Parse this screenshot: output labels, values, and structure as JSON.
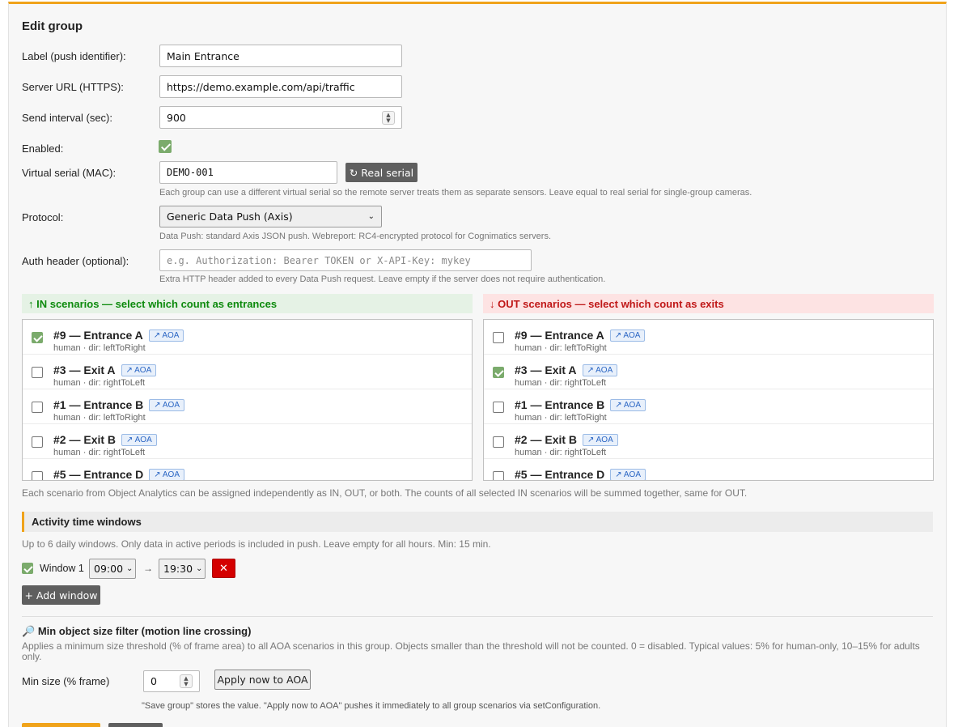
{
  "form": {
    "title": "Edit group",
    "label_field": {
      "label": "Label (push identifier):",
      "value": "Main Entrance"
    },
    "server_url": {
      "label": "Server URL (HTTPS):",
      "value": "https://demo.example.com/api/traffic"
    },
    "send_interval": {
      "label": "Send interval (sec):",
      "value": "900"
    },
    "enabled": {
      "label": "Enabled:",
      "checked": true
    },
    "virtual_serial": {
      "label": "Virtual serial (MAC):",
      "value": "DEMO-001",
      "button": "↻ Real serial",
      "help": "Each group can use a different virtual serial so the remote server treats them as separate sensors. Leave equal to real serial for single-group cameras."
    },
    "protocol": {
      "label": "Protocol:",
      "selected": "Generic Data Push (Axis)",
      "help": "Data Push: standard Axis JSON push. Webreport: RC4-encrypted protocol for Cognimatics servers."
    },
    "auth_header": {
      "label": "Auth header (optional):",
      "placeholder": "e.g. Authorization: Bearer TOKEN  or  X-API-Key: mykey",
      "help": "Extra HTTP header added to every Data Push request. Leave empty if the server does not require authentication."
    }
  },
  "scenarios": {
    "in_header": "↑ IN scenarios — select which count as entrances",
    "out_header": "↓ OUT scenarios — select which count as exits",
    "aoa_badge": "↗ AOA",
    "in": [
      {
        "name": "#9 — Entrance A",
        "meta": "human · dir: leftToRight",
        "checked": true
      },
      {
        "name": "#3 — Exit A",
        "meta": "human · dir: rightToLeft",
        "checked": false
      },
      {
        "name": "#1 — Entrance B",
        "meta": "human · dir: leftToRight",
        "checked": false
      },
      {
        "name": "#2 — Exit B",
        "meta": "human · dir: rightToLeft",
        "checked": false
      },
      {
        "name": "#5 — Entrance D",
        "meta": "",
        "checked": false
      }
    ],
    "out": [
      {
        "name": "#9 — Entrance A",
        "meta": "human · dir: leftToRight",
        "checked": false
      },
      {
        "name": "#3 — Exit A",
        "meta": "human · dir: rightToLeft",
        "checked": true
      },
      {
        "name": "#1 — Entrance B",
        "meta": "human · dir: leftToRight",
        "checked": false
      },
      {
        "name": "#2 — Exit B",
        "meta": "human · dir: rightToLeft",
        "checked": false
      },
      {
        "name": "#5 — Entrance D",
        "meta": "",
        "checked": false
      }
    ],
    "help": "Each scenario from Object Analytics can be assigned independently as IN, OUT, or both. The counts of all selected IN scenarios will be summed together, same for OUT."
  },
  "activity": {
    "title": "Activity time windows",
    "help": "Up to 6 daily windows. Only data in active periods is included in push. Leave empty for all hours. Min: 15 min.",
    "window_label": "Window 1",
    "window_enabled": true,
    "start": "09:00",
    "arrow": "→",
    "end": "19:30",
    "remove": "✕",
    "add_button": "+ Add window"
  },
  "min_size": {
    "icon": "🔎",
    "title": "Min object size filter (motion line crossing)",
    "help": "Applies a minimum size threshold (% of frame area) to all AOA scenarios in this group. Objects smaller than the threshold will not be counted. 0 = disabled. Typical values: 5% for human-only, 10–15% for adults only.",
    "label": "Min size (% frame)",
    "value": "0",
    "apply_button": "Apply now to AOA",
    "note": "\"Save group\" stores the value. \"Apply now to AOA\" pushes it immediately to all group scenarios via setConfiguration."
  },
  "colors": {
    "accent": "#f0a31a",
    "in_green": "#0d8a0d",
    "out_red": "#c01818",
    "check_green": "#7bab6c",
    "danger": "#d40000"
  }
}
